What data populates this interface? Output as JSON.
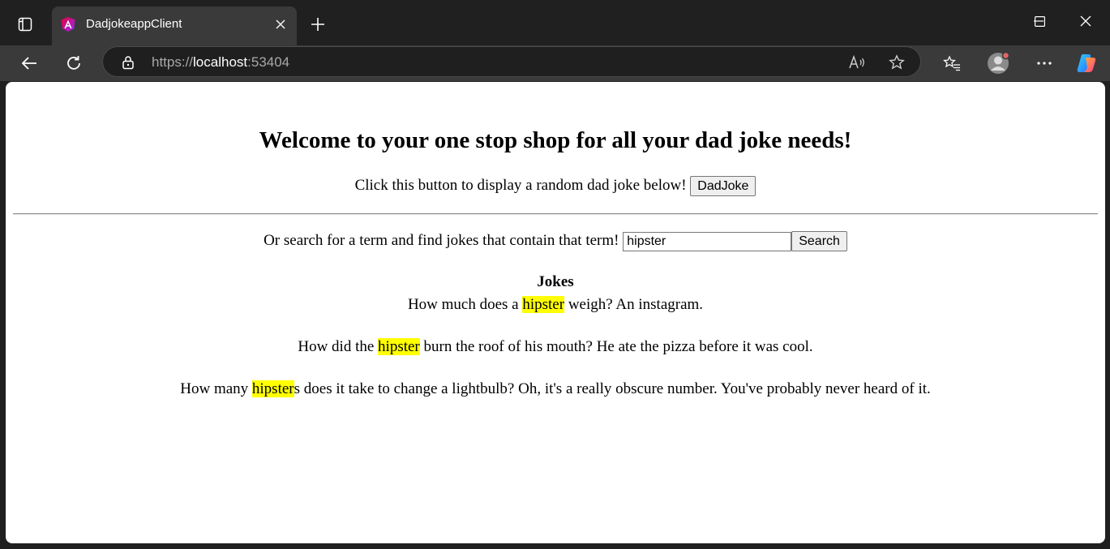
{
  "browser": {
    "tab_title": "DadjokeappClient",
    "url_scheme": "https://",
    "url_host": "localhost",
    "url_port": ":53404",
    "icons": [
      "tab-actions-icon",
      "angular-favicon-icon",
      "close-icon",
      "plus-icon",
      "minimize-icon",
      "maximize-icon",
      "close-window-icon",
      "back-icon",
      "refresh-icon",
      "lock-icon",
      "read-aloud-icon",
      "star-icon",
      "favorites-icon",
      "profile-icon",
      "more-icon",
      "copilot-icon"
    ]
  },
  "page": {
    "heading": "Welcome to your one stop shop for all your dad joke needs!",
    "random_prompt": "Click this button to display a random dad joke below!",
    "random_button": "DadJoke",
    "search_prompt": "Or search for a term and find jokes that contain that term!",
    "search_value": "hipster",
    "search_button": "Search",
    "jokes_title": "Jokes",
    "highlight_color": "#ffff00",
    "jokes": [
      {
        "before": "How much does a ",
        "match": "hipster",
        "after": " weigh? An instagram."
      },
      {
        "before": "How did the ",
        "match": "hipster",
        "after": " burn the roof of his mouth? He ate the pizza before it was cool."
      },
      {
        "before": "How many ",
        "match": "hipster",
        "after": "s does it take to change a lightbulb? Oh, it's a really obscure number. You've probably never heard of it."
      }
    ]
  }
}
